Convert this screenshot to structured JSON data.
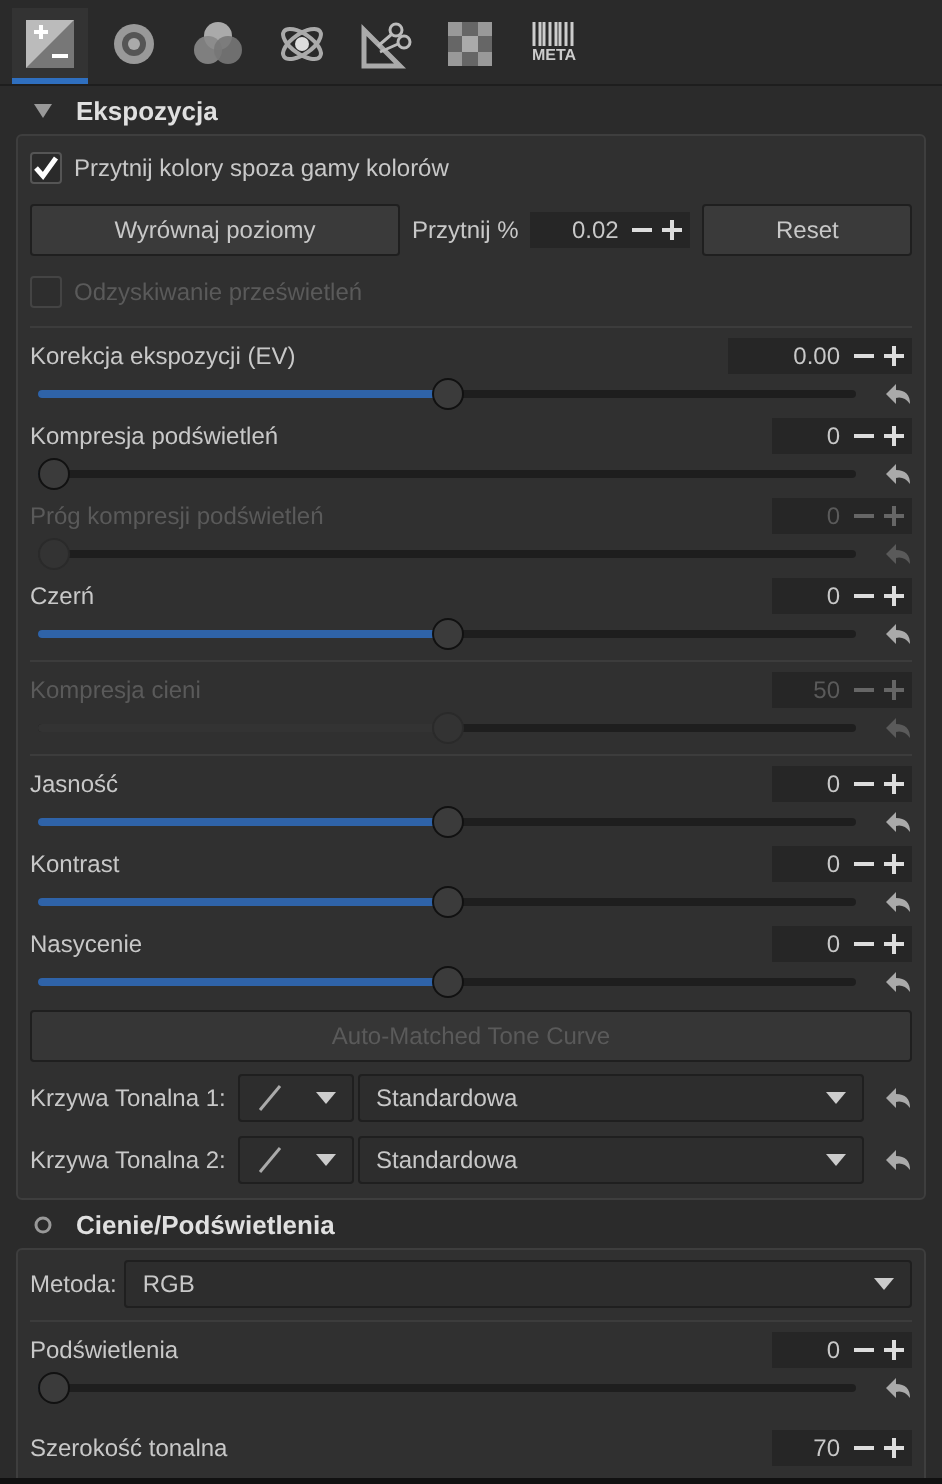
{
  "tabs": [
    {
      "kind": "exposure",
      "selected": true
    },
    {
      "kind": "detail",
      "selected": false
    },
    {
      "kind": "color",
      "selected": false
    },
    {
      "kind": "advanced",
      "selected": false
    },
    {
      "kind": "transform",
      "selected": false
    },
    {
      "kind": "raw",
      "selected": false
    },
    {
      "kind": "metadata",
      "label": "META",
      "selected": false
    }
  ],
  "sections": [
    {
      "title": "Ekspozycja",
      "kind": "expander",
      "items": [
        {
          "kind": "checkbox",
          "label": "Przytnij kolory spoza gamy kolorów",
          "checked": true,
          "disabled": false
        },
        {
          "kind": "levels",
          "button": "Wyrównaj poziomy",
          "label": "Przytnij %",
          "value": "0.02",
          "reset": "Reset"
        },
        {
          "kind": "checkbox",
          "label": "Odzyskiwanie prześwietleń",
          "checked": false,
          "disabled": true
        },
        {
          "kind": "separator"
        },
        {
          "kind": "slider",
          "label": "Korekcja ekspozycji (EV)",
          "value": "0.00",
          "level": 0.5,
          "disabled": false
        },
        {
          "kind": "slider",
          "label": "Kompresja podświetleń",
          "value": "0",
          "level": 0,
          "disabled": false
        },
        {
          "kind": "slider",
          "label": "Próg kompresji podświetleń",
          "value": "0",
          "level": 0,
          "disabled": true
        },
        {
          "kind": "slider",
          "label": "Czerń",
          "value": "0",
          "level": 0.5,
          "disabled": false
        },
        {
          "kind": "separator"
        },
        {
          "kind": "slider",
          "label": "Kompresja cieni",
          "value": "50",
          "level": 0.5,
          "disabled": true
        },
        {
          "kind": "separator"
        },
        {
          "kind": "slider",
          "label": "Jasność",
          "value": "0",
          "level": 0.5,
          "disabled": false
        },
        {
          "kind": "slider",
          "label": "Kontrast",
          "value": "0",
          "level": 0.5,
          "disabled": false
        },
        {
          "kind": "slider",
          "label": "Nasycenie",
          "value": "0",
          "level": 0.5,
          "disabled": false
        },
        {
          "kind": "button",
          "label": "Auto-Matched Tone Curve",
          "disabled": true
        },
        {
          "kind": "curve",
          "label": "Krzywa Tonalna 1:",
          "value": "Standardowa"
        },
        {
          "kind": "curve",
          "label": "Krzywa Tonalna 2:",
          "value": "Standardowa"
        }
      ]
    },
    {
      "title": "Cienie/Podświetlenia",
      "kind": "toggle",
      "items": [
        {
          "kind": "select",
          "label": "Metoda:",
          "value": "RGB"
        },
        {
          "kind": "separator"
        },
        {
          "kind": "slider",
          "label": "Podświetlenia",
          "value": "0",
          "level": 0,
          "disabled": false
        },
        {
          "kind": "slider",
          "label": "Szerokość tonalna",
          "value": "70",
          "disabled": false
        }
      ]
    }
  ]
}
